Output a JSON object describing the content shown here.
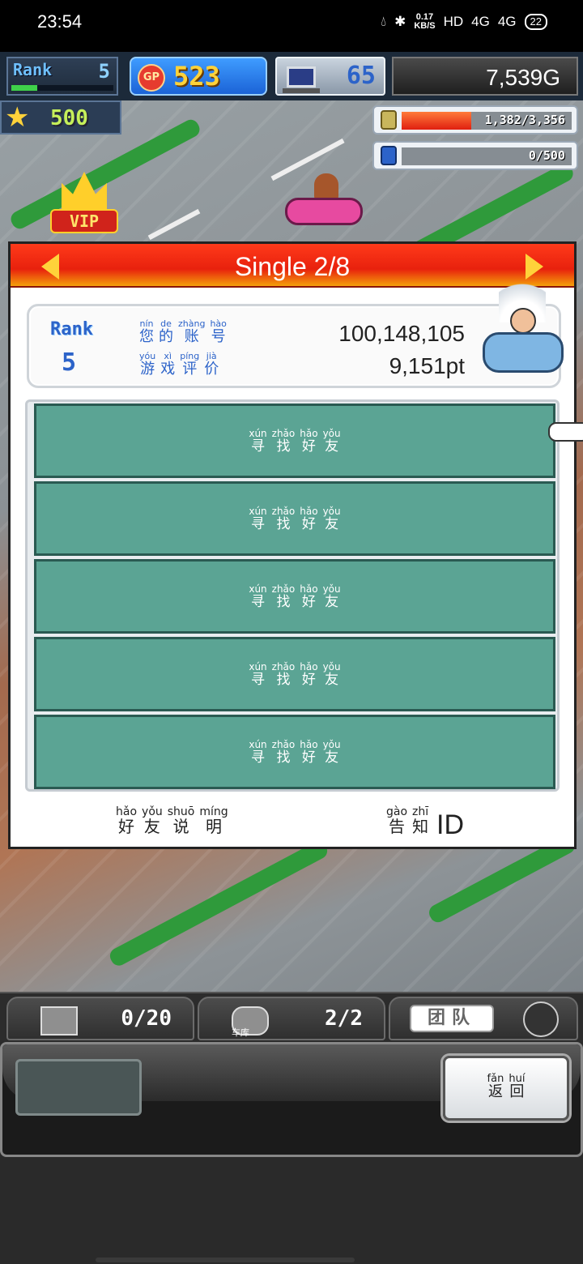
{
  "status_bar": {
    "time": "23:54",
    "speed_value": "0.17",
    "speed_unit": "KB/S",
    "hd": "HD",
    "net1": "4G",
    "net2": "4G",
    "battery": "22"
  },
  "hud": {
    "rank_label": "Rank",
    "rank_value": "5",
    "rank_progress": 0.25,
    "gp_icon": "GP",
    "gp_value": "523",
    "pc_value": "65",
    "money": "7,539G",
    "stars_value": "500",
    "fuel_text": "1,382/3,356",
    "fuel_fraction": 0.41,
    "research_text": "0/500",
    "research_fraction": 0.0
  },
  "vip_label": "VIP",
  "panel": {
    "title": "Single 2/8",
    "player": {
      "rank_label": "Rank",
      "rank_value": "5",
      "account_label": [
        {
          "py": "nín",
          "hz": "您"
        },
        {
          "py": "de",
          "hz": "的"
        },
        {
          "py": "zhàng",
          "hz": "账"
        },
        {
          "py": "hào",
          "hz": "号"
        }
      ],
      "rating_label": [
        {
          "py": "yóu",
          "hz": "游"
        },
        {
          "py": "xì",
          "hz": "戏"
        },
        {
          "py": "píng",
          "hz": "评"
        },
        {
          "py": "jià",
          "hz": "价"
        }
      ],
      "account_id": "100,148,105",
      "rating": "9,151pt"
    },
    "friend_slots": [
      [
        {
          "py": "xún",
          "hz": "寻"
        },
        {
          "py": "zhǎo",
          "hz": "找"
        },
        {
          "py": "hǎo",
          "hz": "好"
        },
        {
          "py": "yǒu",
          "hz": "友"
        }
      ],
      [
        {
          "py": "xún",
          "hz": "寻"
        },
        {
          "py": "zhǎo",
          "hz": "找"
        },
        {
          "py": "hǎo",
          "hz": "好"
        },
        {
          "py": "yǒu",
          "hz": "友"
        }
      ],
      [
        {
          "py": "xún",
          "hz": "寻"
        },
        {
          "py": "zhǎo",
          "hz": "找"
        },
        {
          "py": "hǎo",
          "hz": "好"
        },
        {
          "py": "yǒu",
          "hz": "友"
        }
      ],
      [
        {
          "py": "xún",
          "hz": "寻"
        },
        {
          "py": "zhǎo",
          "hz": "找"
        },
        {
          "py": "hǎo",
          "hz": "好"
        },
        {
          "py": "yǒu",
          "hz": "友"
        }
      ],
      [
        {
          "py": "xún",
          "hz": "寻"
        },
        {
          "py": "zhǎo",
          "hz": "找"
        },
        {
          "py": "hǎo",
          "hz": "好"
        },
        {
          "py": "yǒu",
          "hz": "友"
        }
      ]
    ],
    "footer_left": [
      {
        "py": "hǎo",
        "hz": "好"
      },
      {
        "py": "yǒu",
        "hz": "友"
      },
      {
        "py": "shuō",
        "hz": "说"
      },
      {
        "py": "míng",
        "hz": "明"
      }
    ],
    "footer_right": [
      {
        "py": "gào",
        "hz": "告"
      },
      {
        "py": "zhī",
        "hz": "知"
      }
    ],
    "footer_right_suffix": "ID"
  },
  "tabbar": {
    "tab1_value": "0/20",
    "tab2_small": "车库",
    "tab2_value": "2/2",
    "tab3_label": "团队"
  },
  "back_button": [
    {
      "py": "fǎn",
      "hz": "返"
    },
    {
      "py": "huí",
      "hz": "回"
    }
  ],
  "colors": {
    "header_red": "#e8210d",
    "slot_teal": "#5ba494",
    "gp_blue": "#1b63d6",
    "gold": "#ffd23a"
  },
  "icons": [
    "bluetooth-icon",
    "signal-icon",
    "battery-icon",
    "gp-coin-icon",
    "computer-icon",
    "star-icon",
    "fuel-can-icon",
    "research-bottle-icon",
    "vip-crown-icon",
    "left-arrow-icon",
    "right-arrow-icon",
    "pointing-hand-icon",
    "crate-icon",
    "garage-car-icon",
    "avatar-icon"
  ]
}
